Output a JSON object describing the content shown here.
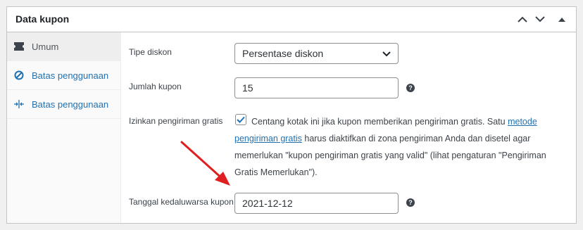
{
  "panel": {
    "title": "Data kupon",
    "controls": [
      "chevron-up-icon",
      "chevron-down-icon",
      "triangle-up-icon"
    ]
  },
  "sidebar": {
    "items": [
      {
        "label": "Umum",
        "icon": "ticket-icon",
        "active": true
      },
      {
        "label": "Batas penggunaan",
        "icon": "no-entry-icon",
        "active": false
      },
      {
        "label": "Batas penggunaan",
        "icon": "arrows-in-icon",
        "active": false
      }
    ]
  },
  "form": {
    "discount_type": {
      "label": "Tipe diskon",
      "value": "Persentase diskon"
    },
    "coupon_amount": {
      "label": "Jumlah kupon",
      "value": "15"
    },
    "free_shipping": {
      "label": "Izinkan pengiriman gratis",
      "checked": true,
      "desc_before": "Centang kotak ini jika kupon memberikan pengiriman gratis. Satu ",
      "desc_link": "metode pengiriman gratis",
      "desc_after": " harus diaktifkan di zona pengiriman Anda dan disetel agar memerlukan \"kupon pengiriman gratis yang valid\" (lihat pengaturan \"Pengiriman Gratis Memerlukan\")."
    },
    "expiry_date": {
      "label": "Tanggal kedaluwarsa kupon",
      "value": "2021-12-12"
    },
    "help_glyph": "?"
  },
  "colors": {
    "accent": "#2271b1",
    "annotation_arrow": "#e02020"
  }
}
